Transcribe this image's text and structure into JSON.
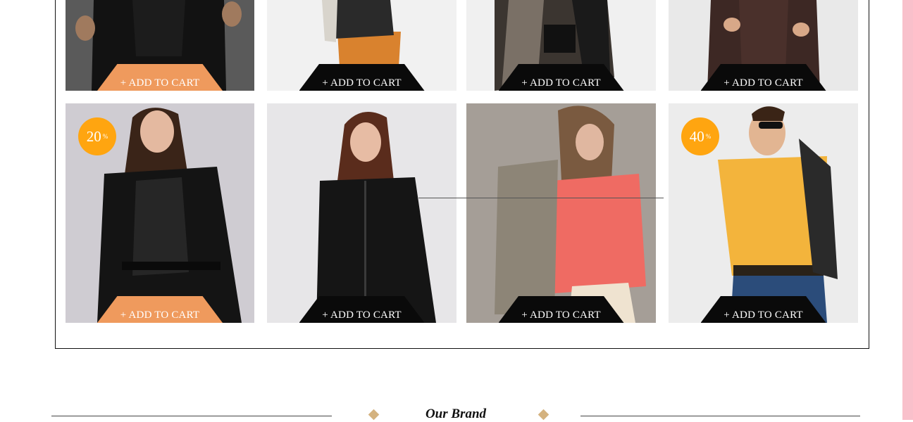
{
  "cart_label": "+ ADD TO CART",
  "products_row1": [
    {
      "name": "product-black-shirt-man",
      "button_style": "orange"
    },
    {
      "name": "product-leather-jacket-orange-skirt",
      "button_style": "black"
    },
    {
      "name": "product-plaid-poncho",
      "button_style": "black"
    },
    {
      "name": "product-brown-leather-coat",
      "button_style": "black"
    }
  ],
  "products_row2": [
    {
      "name": "product-black-biker-jacket",
      "button_style": "orange",
      "discount": "20",
      "discount_unit": "%"
    },
    {
      "name": "product-black-zip-jacket",
      "button_style": "black"
    },
    {
      "name": "product-grey-jacket-coral-sweater",
      "button_style": "black"
    },
    {
      "name": "product-yellow-tshirt-man",
      "button_style": "black",
      "discount": "40",
      "discount_unit": "%"
    }
  ],
  "section_title": "Our Brand",
  "colors": {
    "accent_orange": "#ef9a5d",
    "badge": "#ffa510",
    "diamond": "#d4b27f",
    "side_strip": "#f9c0cb"
  }
}
